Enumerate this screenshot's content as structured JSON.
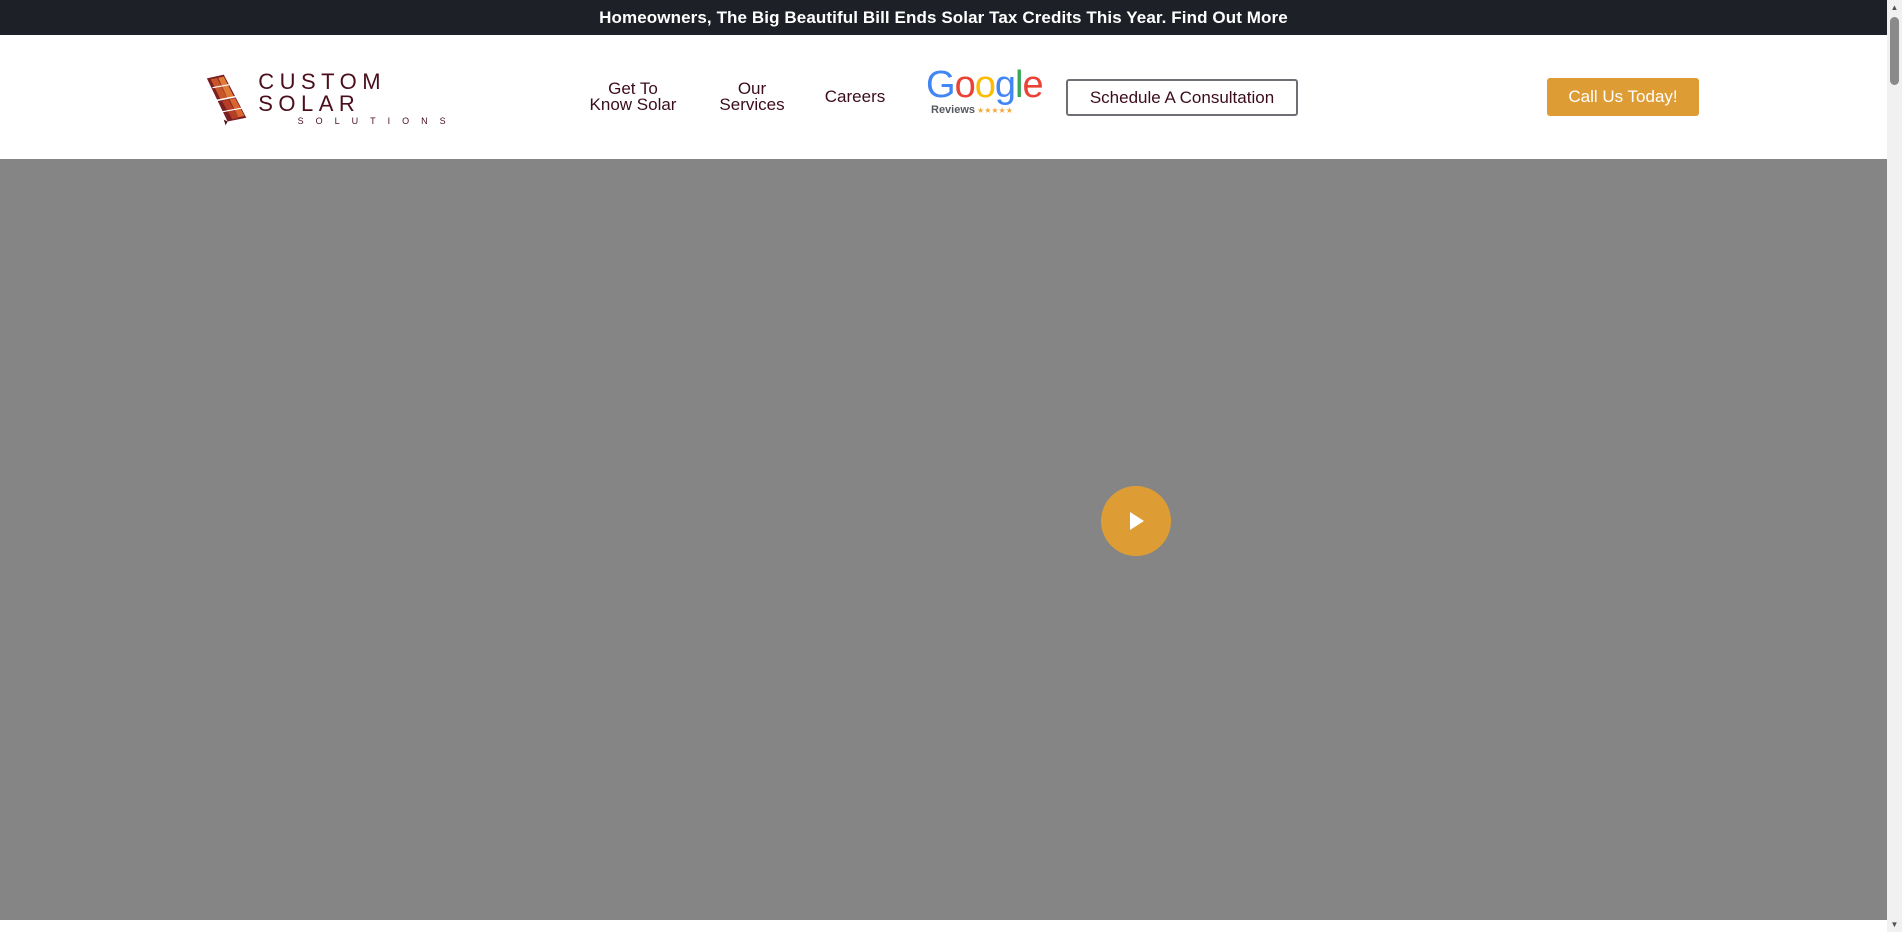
{
  "announcement": {
    "text": "Homeowners, The Big Beautiful Bill Ends Solar Tax Credits This Year. Find Out More"
  },
  "logo": {
    "title": "CUSTOM SOLAR",
    "subtitle": "SOLUTIONS",
    "icon": "solar-panel-logo-icon"
  },
  "nav": {
    "know_solar": "Get To\nKnow Solar",
    "services": "Our\nServices",
    "careers": "Careers"
  },
  "google_reviews": {
    "letters": [
      "G",
      "o",
      "o",
      "g",
      "l",
      "e"
    ],
    "label": "Reviews",
    "stars": "★★★★★",
    "rating_stars": 5
  },
  "buttons": {
    "consultation": "Schedule A Consultation",
    "call": "Call Us Today!"
  },
  "hero": {
    "play_icon": "play-icon"
  },
  "colors": {
    "announcement_bg": "#1d2026",
    "brand_maroon": "#4a0f1c",
    "accent_gold": "#de9c35",
    "video_placeholder": "#858585"
  }
}
